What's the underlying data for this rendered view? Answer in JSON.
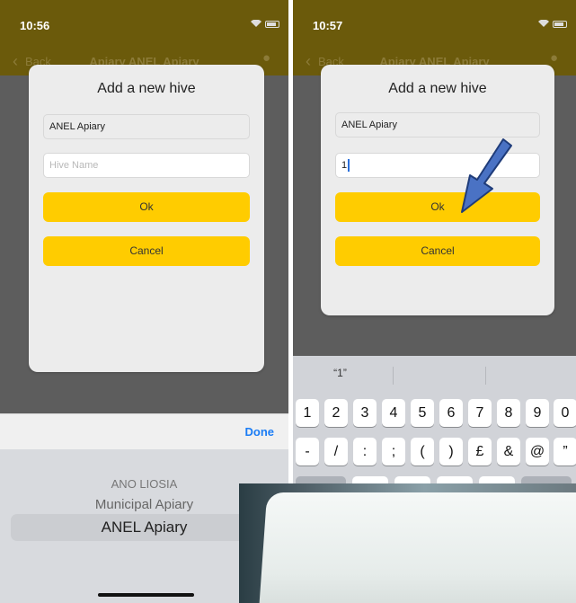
{
  "left_screen": {
    "time": "10:56",
    "nav": {
      "back": "Back",
      "title": "Apiary ANEL Apiary"
    },
    "dialog": {
      "title": "Add a new hive",
      "apiary_value": "ANEL Apiary",
      "hive_placeholder": "Hive Name",
      "ok_label": "Ok",
      "cancel_label": "Cancel"
    },
    "picker": {
      "done_label": "Done",
      "options": [
        "ANO LIOSIA",
        "Municipal Apiary",
        "ANEL Apiary"
      ],
      "selected": "ANEL Apiary"
    }
  },
  "right_screen": {
    "time": "10:57",
    "nav": {
      "back": "Back",
      "title": "Apiary ANEL Apiary"
    },
    "dialog": {
      "title": "Add a new hive",
      "apiary_value": "ANEL Apiary",
      "hive_value": "1",
      "ok_label": "Ok",
      "cancel_label": "Cancel"
    },
    "keyboard": {
      "suggestion": "“1”",
      "row1": [
        "1",
        "2",
        "3",
        "4",
        "5",
        "6",
        "7",
        "8",
        "9",
        "0"
      ],
      "row2": [
        "-",
        "/",
        ":",
        ";",
        "(",
        ")",
        "£",
        "&",
        "@",
        "”"
      ]
    }
  },
  "colors": {
    "accent": "#ffcc00",
    "done_blue": "#1a7cf5",
    "arrow": "#4a72c4"
  }
}
